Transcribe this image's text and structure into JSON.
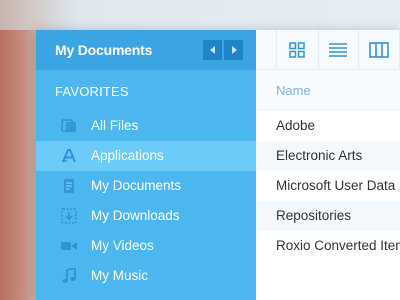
{
  "sidebar": {
    "title": "My Documents",
    "section_label": "FAVORITES",
    "items": [
      {
        "label": "All Files",
        "icon": "all-files-icon"
      },
      {
        "label": "Applications",
        "icon": "applications-icon",
        "active": true
      },
      {
        "label": "My Documents",
        "icon": "documents-icon"
      },
      {
        "label": "My Downloads",
        "icon": "downloads-icon"
      },
      {
        "label": "My Videos",
        "icon": "video-camera-icon"
      },
      {
        "label": "My Music",
        "icon": "music-note-icon"
      }
    ]
  },
  "toolbar": {
    "views": [
      "grid-view-icon",
      "list-view-icon",
      "column-view-icon"
    ]
  },
  "table": {
    "column_name": "Name",
    "rows": [
      "Adobe",
      "Electronic Arts",
      "Microsoft User Data",
      "Repositories",
      "Roxio Converted Item"
    ]
  },
  "colors": {
    "sidebar_bg": "#4cb6ef",
    "sidebar_header": "#3ba4e2",
    "active_item": "#6ccaf8",
    "nav_button": "#1f85c8",
    "accent_icon": "#2f93d6"
  }
}
